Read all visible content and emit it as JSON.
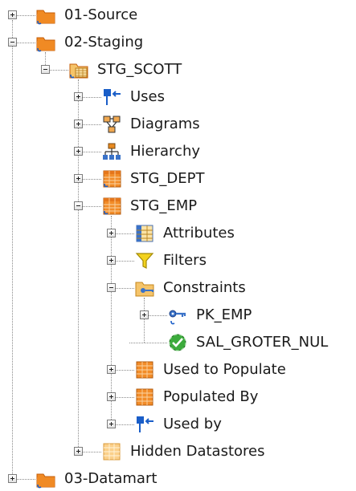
{
  "window": "ODI Designer — Models tree",
  "tree": {
    "nodes": [
      {
        "label": "01-Source",
        "level": 0,
        "state": "collapsed",
        "icon": "model-folder-icon"
      },
      {
        "label": "02-Staging",
        "level": 0,
        "state": "expanded",
        "icon": "model-folder-icon"
      },
      {
        "label": "STG_SCOTT",
        "level": 1,
        "state": "expanded",
        "icon": "model-icon"
      },
      {
        "label": "Uses",
        "level": 2,
        "state": "collapsed",
        "icon": "uses-icon"
      },
      {
        "label": "Diagrams",
        "level": 2,
        "state": "collapsed",
        "icon": "diagrams-icon"
      },
      {
        "label": "Hierarchy",
        "level": 2,
        "state": "collapsed",
        "icon": "hierarchy-icon"
      },
      {
        "label": "STG_DEPT",
        "level": 2,
        "state": "collapsed",
        "icon": "datastore-icon"
      },
      {
        "label": "STG_EMP",
        "level": 2,
        "state": "expanded",
        "icon": "datastore-icon"
      },
      {
        "label": "Attributes",
        "level": 3,
        "state": "collapsed",
        "icon": "attributes-icon"
      },
      {
        "label": "Filters",
        "level": 3,
        "state": "collapsed",
        "icon": "filter-icon"
      },
      {
        "label": "Constraints",
        "level": 3,
        "state": "expanded",
        "icon": "constraints-folder-icon"
      },
      {
        "label": "PK_EMP",
        "level": 4,
        "state": "collapsed",
        "icon": "primary-key-icon"
      },
      {
        "label": "SAL_GROTER_NUL",
        "level": 4,
        "state": "leaf",
        "icon": "check-constraint-icon"
      },
      {
        "label": "Used to Populate",
        "level": 3,
        "state": "collapsed",
        "icon": "used-to-populate-icon"
      },
      {
        "label": "Populated By",
        "level": 3,
        "state": "collapsed",
        "icon": "populated-by-icon"
      },
      {
        "label": "Used by",
        "level": 3,
        "state": "collapsed",
        "icon": "used-by-icon"
      },
      {
        "label": "Hidden Datastores",
        "level": 2,
        "state": "collapsed",
        "icon": "hidden-datastores-icon"
      },
      {
        "label": "03-Datamart",
        "level": 0,
        "state": "collapsed",
        "icon": "model-folder-icon"
      }
    ]
  },
  "colors": {
    "folder": "#f08a24",
    "folder_dark": "#c45e0a",
    "datastore": "#f28c28",
    "blue_accent": "#1a5ec8",
    "connector": "#8a8a8a",
    "text": "#1a1a1a"
  }
}
